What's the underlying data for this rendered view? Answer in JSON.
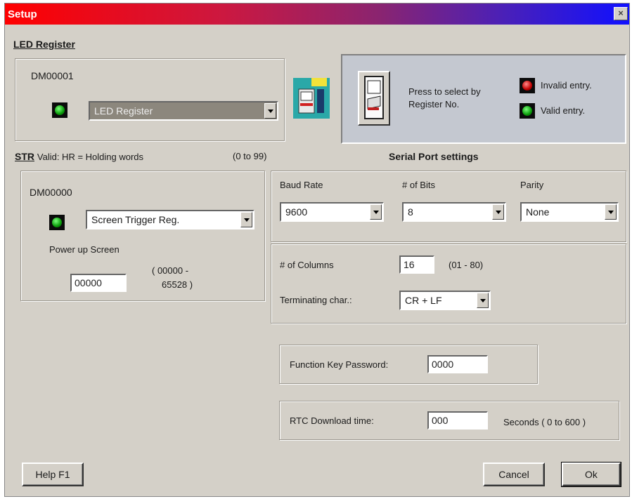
{
  "window": {
    "title": "Setup",
    "close_glyph": "×"
  },
  "led_section": {
    "heading": "LED Register",
    "address": "DM00001",
    "combo_value": "LED Register"
  },
  "register_panel": {
    "press_text_line1": "Press to select by",
    "press_text_line2": "Register No.",
    "invalid_label": "Invalid entry.",
    "valid_label": "Valid entry."
  },
  "str_section": {
    "heading_bold": "STR",
    "heading_rest": "Valid: HR = Holding words",
    "range": "(0 to 99)",
    "address": "DM00000",
    "combo_value": "Screen Trigger Reg.",
    "powerup_label": "Power up Screen",
    "powerup_value": "00000",
    "powerup_range_line1": "( 00000 -",
    "powerup_range_line2": "65528 )"
  },
  "serial": {
    "heading": "Serial Port settings",
    "baud_label": "Baud Rate",
    "baud_value": "9600",
    "bits_label": "# of Bits",
    "bits_value": "8",
    "parity_label": "Parity",
    "parity_value": "None",
    "columns_label": "# of Columns",
    "columns_value": "16",
    "columns_range": "(01 - 80)",
    "term_label": "Terminating char.:",
    "term_value": "CR + LF"
  },
  "password": {
    "label": "Function Key Password:",
    "value": "0000"
  },
  "rtc": {
    "label": "RTC Download time:",
    "value": "000",
    "unit": "Seconds ( 0 to 600 )"
  },
  "buttons": {
    "help": "Help F1",
    "cancel": "Cancel",
    "ok": "Ok"
  },
  "colors": {
    "face": "#d4d0c8",
    "led_on": "#0a9a0a",
    "led_invalid": "#c00000"
  }
}
